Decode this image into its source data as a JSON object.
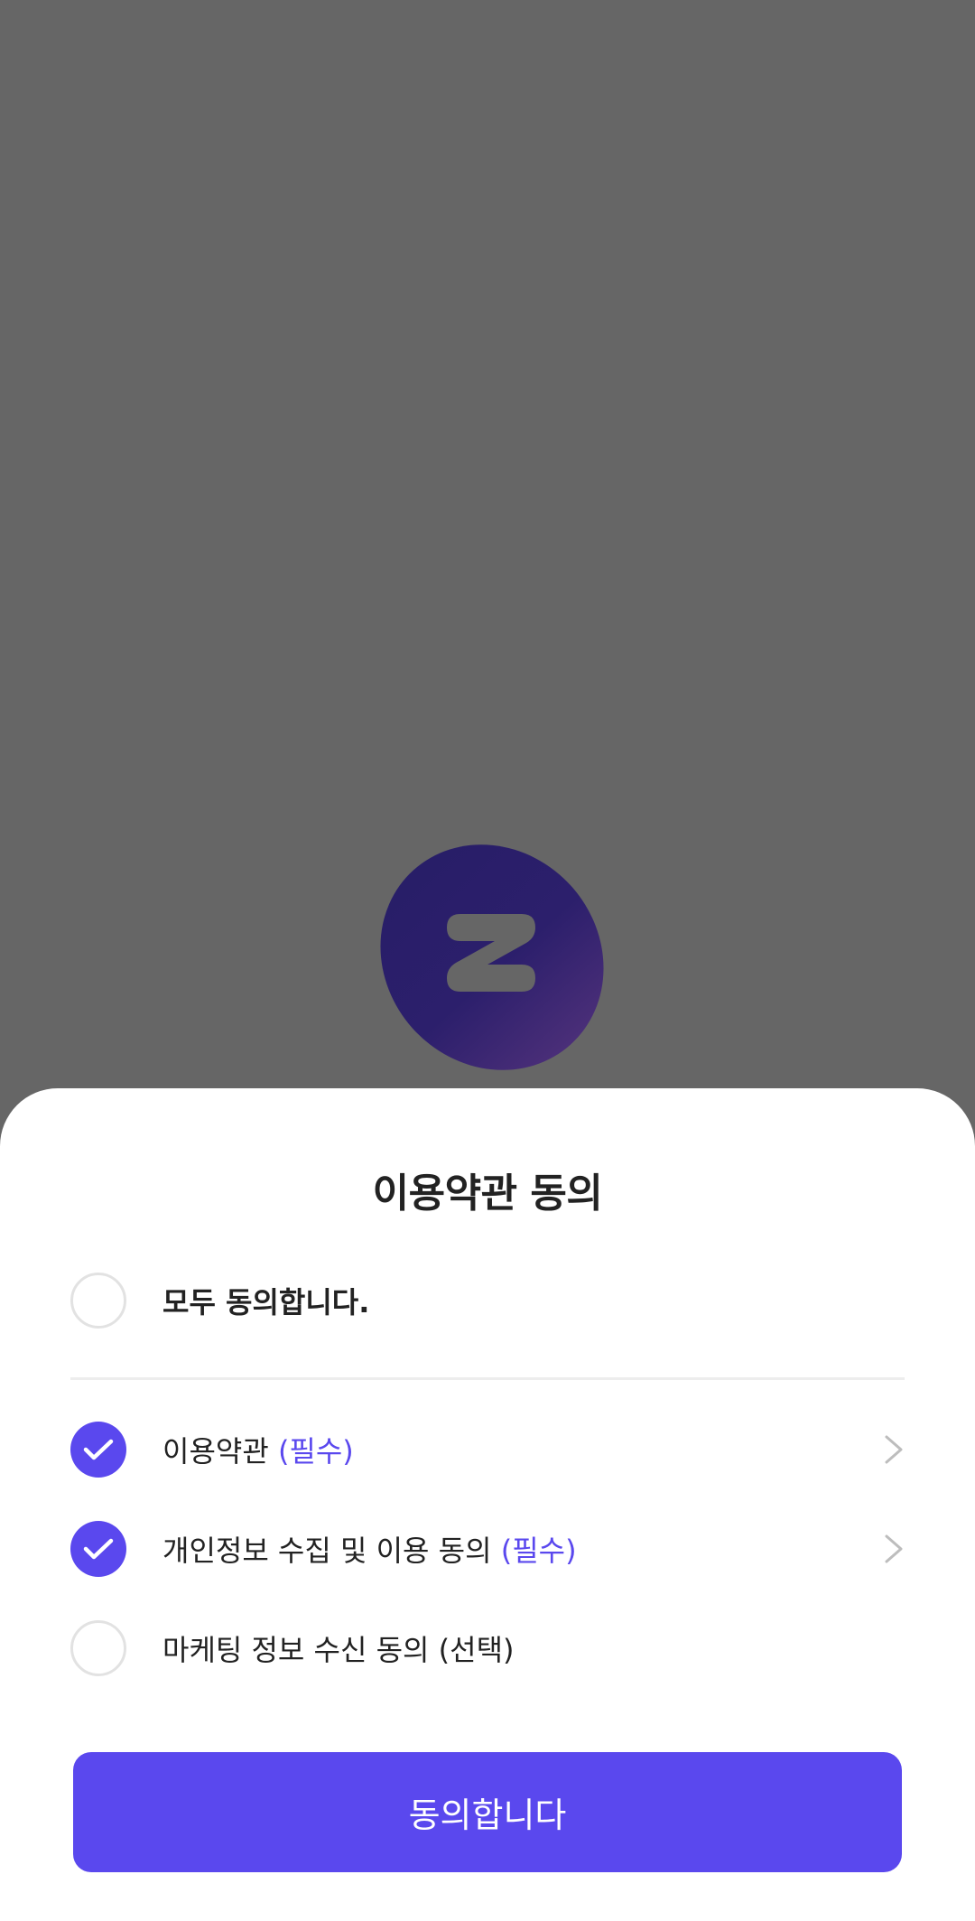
{
  "sheet": {
    "title": "이용약관 동의",
    "agree_all_label": "모두 동의합니다.",
    "items": [
      {
        "label": "이용약관",
        "tag": "(필수)",
        "checked": true,
        "has_detail": true
      },
      {
        "label": "개인정보 수집 및 이용 동의",
        "tag": "(필수)",
        "checked": true,
        "has_detail": true
      },
      {
        "label": "마케팅 정보 수신 동의 (선택)",
        "tag": "",
        "checked": false,
        "has_detail": false
      }
    ],
    "agree_all_checked": false,
    "submit_label": "동의합니다"
  },
  "colors": {
    "accent": "#5a48ee",
    "backdrop": "#666666",
    "logo_dark": "#2a1f6a",
    "logo_light": "#4a2f78"
  },
  "icons": [
    "z-logo-icon",
    "checkmark-icon",
    "chevron-right-icon"
  ]
}
